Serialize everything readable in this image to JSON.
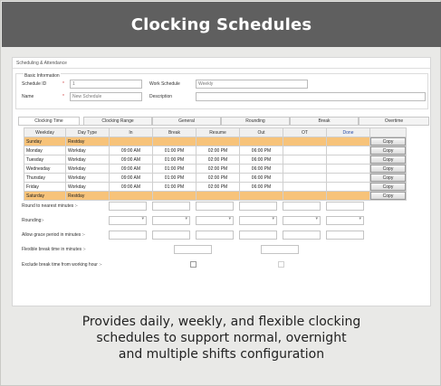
{
  "banner": {
    "title": "Clocking Schedules"
  },
  "breadcrumb": "Scheduling & Attendance",
  "basic_info": {
    "legend": "Basic Information",
    "schedule_id_label": "Schedule ID",
    "schedule_id_required": "*",
    "schedule_id_value": "1",
    "name_label": "Name",
    "name_required": "*",
    "name_placeholder": "New Schedule",
    "work_schedule_label": "Work Schedule",
    "work_schedule_value": "Weekly",
    "description_label": "Description",
    "description_value": ""
  },
  "tabs": [
    {
      "label": "Clocking Time",
      "active": true
    },
    {
      "label": "Clocking Range",
      "active": false
    },
    {
      "label": "General",
      "active": false
    },
    {
      "label": "Rounding",
      "active": false
    },
    {
      "label": "Break",
      "active": false
    },
    {
      "label": "Overtime",
      "active": false
    }
  ],
  "table": {
    "headers": [
      "Weekday",
      "Day Type",
      "In",
      "Break",
      "Resume",
      "Out",
      "OT",
      "Done"
    ],
    "copy_label": "Copy",
    "rows": [
      {
        "weekday": "Sunday",
        "day_type": "Restday",
        "in": "",
        "break": "",
        "resume": "",
        "out": "",
        "ot": "",
        "done": "",
        "restday": true
      },
      {
        "weekday": "Monday",
        "day_type": "Workday",
        "in": "09:00 AM",
        "break": "01:00 PM",
        "resume": "02:00 PM",
        "out": "06:00 PM",
        "ot": "",
        "done": "",
        "restday": false
      },
      {
        "weekday": "Tuesday",
        "day_type": "Workday",
        "in": "09:00 AM",
        "break": "01:00 PM",
        "resume": "02:00 PM",
        "out": "06:00 PM",
        "ot": "",
        "done": "",
        "restday": false
      },
      {
        "weekday": "Wednesday",
        "day_type": "Workday",
        "in": "09:00 AM",
        "break": "01:00 PM",
        "resume": "02:00 PM",
        "out": "06:00 PM",
        "ot": "",
        "done": "",
        "restday": false
      },
      {
        "weekday": "Thursday",
        "day_type": "Workday",
        "in": "09:00 AM",
        "break": "01:00 PM",
        "resume": "02:00 PM",
        "out": "06:00 PM",
        "ot": "",
        "done": "",
        "restday": false
      },
      {
        "weekday": "Friday",
        "day_type": "Workday",
        "in": "09:00 AM",
        "break": "01:00 PM",
        "resume": "02:00 PM",
        "out": "06:00 PM",
        "ot": "",
        "done": "",
        "restday": false
      },
      {
        "weekday": "Saturday",
        "day_type": "Restday",
        "in": "",
        "break": "",
        "resume": "",
        "out": "",
        "ot": "",
        "done": "",
        "restday": true
      }
    ]
  },
  "options": {
    "round_label": "Round to nearest minutes :-",
    "rounding_label": "Rounding:-",
    "grace_label": "Allow grace period in minutes :-",
    "flexible_label": "Flexible break time in minutes :-",
    "exclude_label": "Exclude break time from working hour :-"
  },
  "caption": {
    "line1": "Provides daily, weekly, and flexible clocking",
    "line2": "schedules to support normal, overnight",
    "line3": "and multiple shifts configuration"
  },
  "colors": {
    "banner_bg": "#5f5f5f",
    "restday_row": "#f7c37a",
    "done_header": "#2a4da8",
    "frame_bg": "#e9e9e7"
  }
}
